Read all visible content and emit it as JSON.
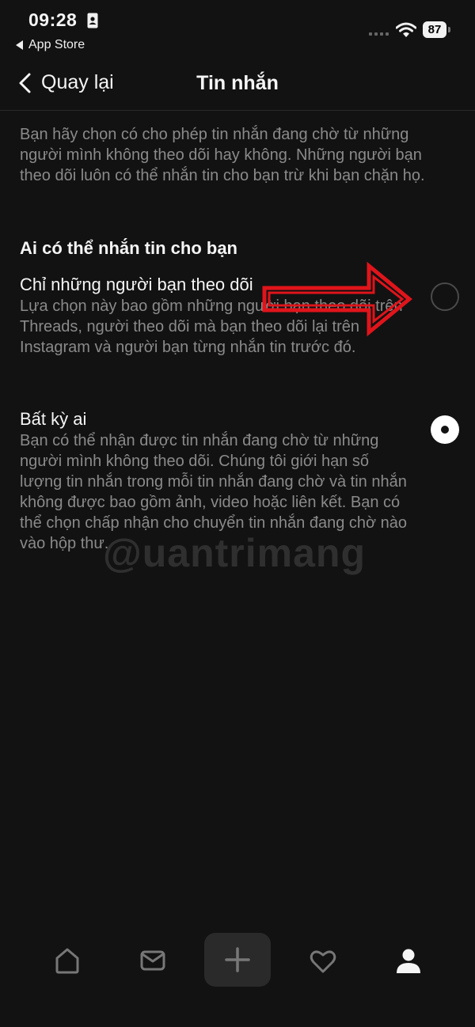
{
  "status_bar": {
    "time": "09:28",
    "back_app": "App Store",
    "battery": "87"
  },
  "header": {
    "back_label": "Quay lại",
    "title": "Tin nhắn"
  },
  "intro": "Bạn hãy chọn có cho phép tin nhắn đang chờ từ những người mình không theo dõi hay không. Những người bạn theo dõi luôn có thể nhắn tin cho bạn trừ khi bạn chặn họ.",
  "section_title": "Ai có thể nhắn tin cho bạn",
  "options": [
    {
      "label": "Chỉ những người bạn theo dõi",
      "description": "Lựa chọn này bao gồm những người bạn theo dõi trên Threads, người theo dõi mà bạn theo dõi lại trên Instagram và người bạn từng nhắn tin trước đó.",
      "selected": false
    },
    {
      "label": "Bất kỳ ai",
      "description": "Bạn có thể nhận được tin nhắn đang chờ từ những người mình không theo dõi. Chúng tôi giới hạn số lượng tin nhắn trong mỗi tin nhắn đang chờ và tin nhắn không được bao gồm ảnh, video hoặc liên kết. Bạn có thể chọn chấp nhận cho chuyển tin nhắn đang chờ nào vào hộp thư.",
      "selected": true
    }
  ],
  "watermark": "@uantrimang",
  "nav": [
    "home-icon",
    "inbox-icon",
    "plus-icon",
    "heart-icon",
    "profile-icon"
  ],
  "colors": {
    "background": "#121212",
    "text": "#f5f5f5",
    "secondary_text": "#8a8a8a",
    "annotation_arrow": "#e0141b"
  }
}
